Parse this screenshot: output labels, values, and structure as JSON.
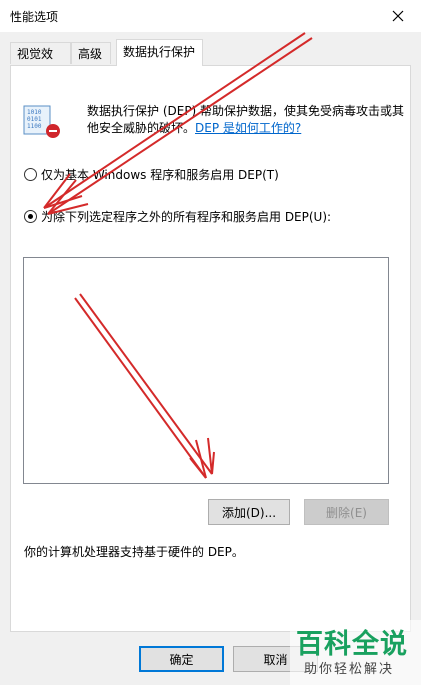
{
  "window": {
    "title": "性能选项"
  },
  "tabs": [
    {
      "label": "视觉效果"
    },
    {
      "label": "高级"
    },
    {
      "label": "数据执行保护"
    }
  ],
  "dep": {
    "description": "数据执行保护 (DEP) 帮助保护数据，使其免受病毒攻击或其他安全威胁的破坏。",
    "link": "DEP 是如何工作的?",
    "option_basic": "仅为基本 Windows 程序和服务启用 DEP(T)",
    "option_all": "为除下列选定程序之外的所有程序和服务启用 DEP(U):",
    "add_button": "添加(D)...",
    "remove_button": "删除(E)",
    "hardware_support": "你的计算机处理器支持基于硬件的 DEP。"
  },
  "dialog_buttons": {
    "ok": "确定",
    "cancel": "取消"
  },
  "watermark": {
    "main": "百科全说",
    "sub": "助你轻松解决"
  },
  "colors": {
    "annotation_arrow": "#d42a2a",
    "link": "#0066cc",
    "watermark_green": "#19a15f"
  }
}
